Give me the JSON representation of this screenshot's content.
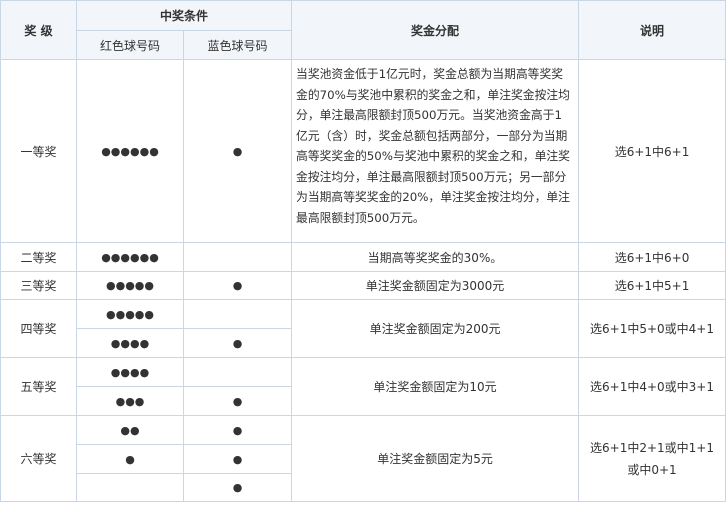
{
  "header": {
    "level": "奖 级",
    "condition": "中奖条件",
    "red": "红色球号码",
    "blue": "蓝色球号码",
    "distribution": "奖金分配",
    "note": "说明"
  },
  "rows": {
    "p1": {
      "level": "一等奖",
      "red": "●●●●●●",
      "blue": "●",
      "dist": "当奖池资金低于1亿元时，奖金总额为当期高等奖奖金的70%与奖池中累积的奖金之和，单注奖金按注均分，单注最高限额封顶500万元。当奖池资金高于1亿元（含）时，奖金总额包括两部分，一部分为当期高等奖奖金的50%与奖池中累积的奖金之和，单注奖金按注均分，单注最高限额封顶500万元；另一部分为当期高等奖奖金的20%，单注奖金按注均分，单注最高限额封顶500万元。",
      "note": "选6+1中6+1"
    },
    "p2": {
      "level": "二等奖",
      "red": "●●●●●●",
      "blue": "",
      "dist": "当期高等奖奖金的30%。",
      "note": "选6+1中6+0"
    },
    "p3": {
      "level": "三等奖",
      "red": "●●●●●",
      "blue": "●",
      "dist": "单注奖金额固定为3000元",
      "note": "选6+1中5+1"
    },
    "p4": {
      "level": "四等奖",
      "red_a": "●●●●●",
      "blue_a": "",
      "red_b": "●●●●",
      "blue_b": "●",
      "dist": "单注奖金额固定为200元",
      "note": "选6+1中5+0或中4+1"
    },
    "p5": {
      "level": "五等奖",
      "red_a": "●●●●",
      "blue_a": "",
      "red_b": "●●●",
      "blue_b": "●",
      "dist": "单注奖金额固定为10元",
      "note": "选6+1中4+0或中3+1"
    },
    "p6": {
      "level": "六等奖",
      "red_a": "●●",
      "blue_a": "●",
      "red_b": "●",
      "blue_b": "●",
      "red_c": "",
      "blue_c": "●",
      "dist": "单注奖金额固定为5元",
      "note": "选6+1中2+1或中1+1或中0+1"
    }
  },
  "colors": {
    "border": "#c8d7e6",
    "header_bg": "#f2f6fa",
    "text": "#333333"
  }
}
